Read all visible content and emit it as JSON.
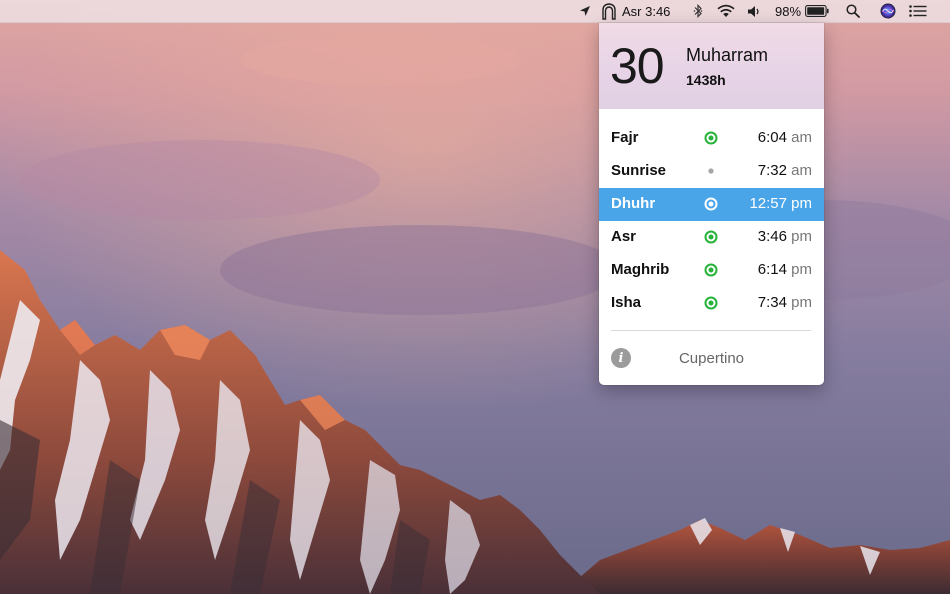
{
  "menubar": {
    "location_icon": "location-arrow-icon",
    "prayer_icon": "mosque-arch-icon",
    "current_prayer": "Asr 3:46",
    "bluetooth_icon": "bluetooth-icon",
    "wifi_icon": "wifi-icon",
    "volume_icon": "volume-icon",
    "battery_percent": "98%",
    "battery_level": 0.98,
    "battery_icon": "battery-icon",
    "search_icon": "spotlight-search-icon",
    "siri_icon": "siri-icon",
    "notification_icon": "notification-center-icon"
  },
  "popover": {
    "day": "30",
    "month": "Muharram",
    "year": "1438h",
    "prayers": [
      {
        "name": "Fajr",
        "time": "6:04",
        "ampm": "am",
        "indicator": "ring-green",
        "active": false
      },
      {
        "name": "Sunrise",
        "time": "7:32",
        "ampm": "am",
        "indicator": "dot-gray",
        "active": false
      },
      {
        "name": "Dhuhr",
        "time": "12:57",
        "ampm": "pm",
        "indicator": "ring-white",
        "active": true
      },
      {
        "name": "Asr",
        "time": "3:46",
        "ampm": "pm",
        "indicator": "ring-green",
        "active": false
      },
      {
        "name": "Maghrib",
        "time": "6:14",
        "ampm": "pm",
        "indicator": "ring-green",
        "active": false
      },
      {
        "name": "Isha",
        "time": "7:34",
        "ampm": "pm",
        "indicator": "ring-green",
        "active": false
      }
    ],
    "info_icon": "info-icon",
    "location": "Cupertino"
  },
  "colors": {
    "active_row": "#4aa5e8",
    "indicator_green": "#27b33a",
    "header_tint": "#e6d3e6"
  }
}
